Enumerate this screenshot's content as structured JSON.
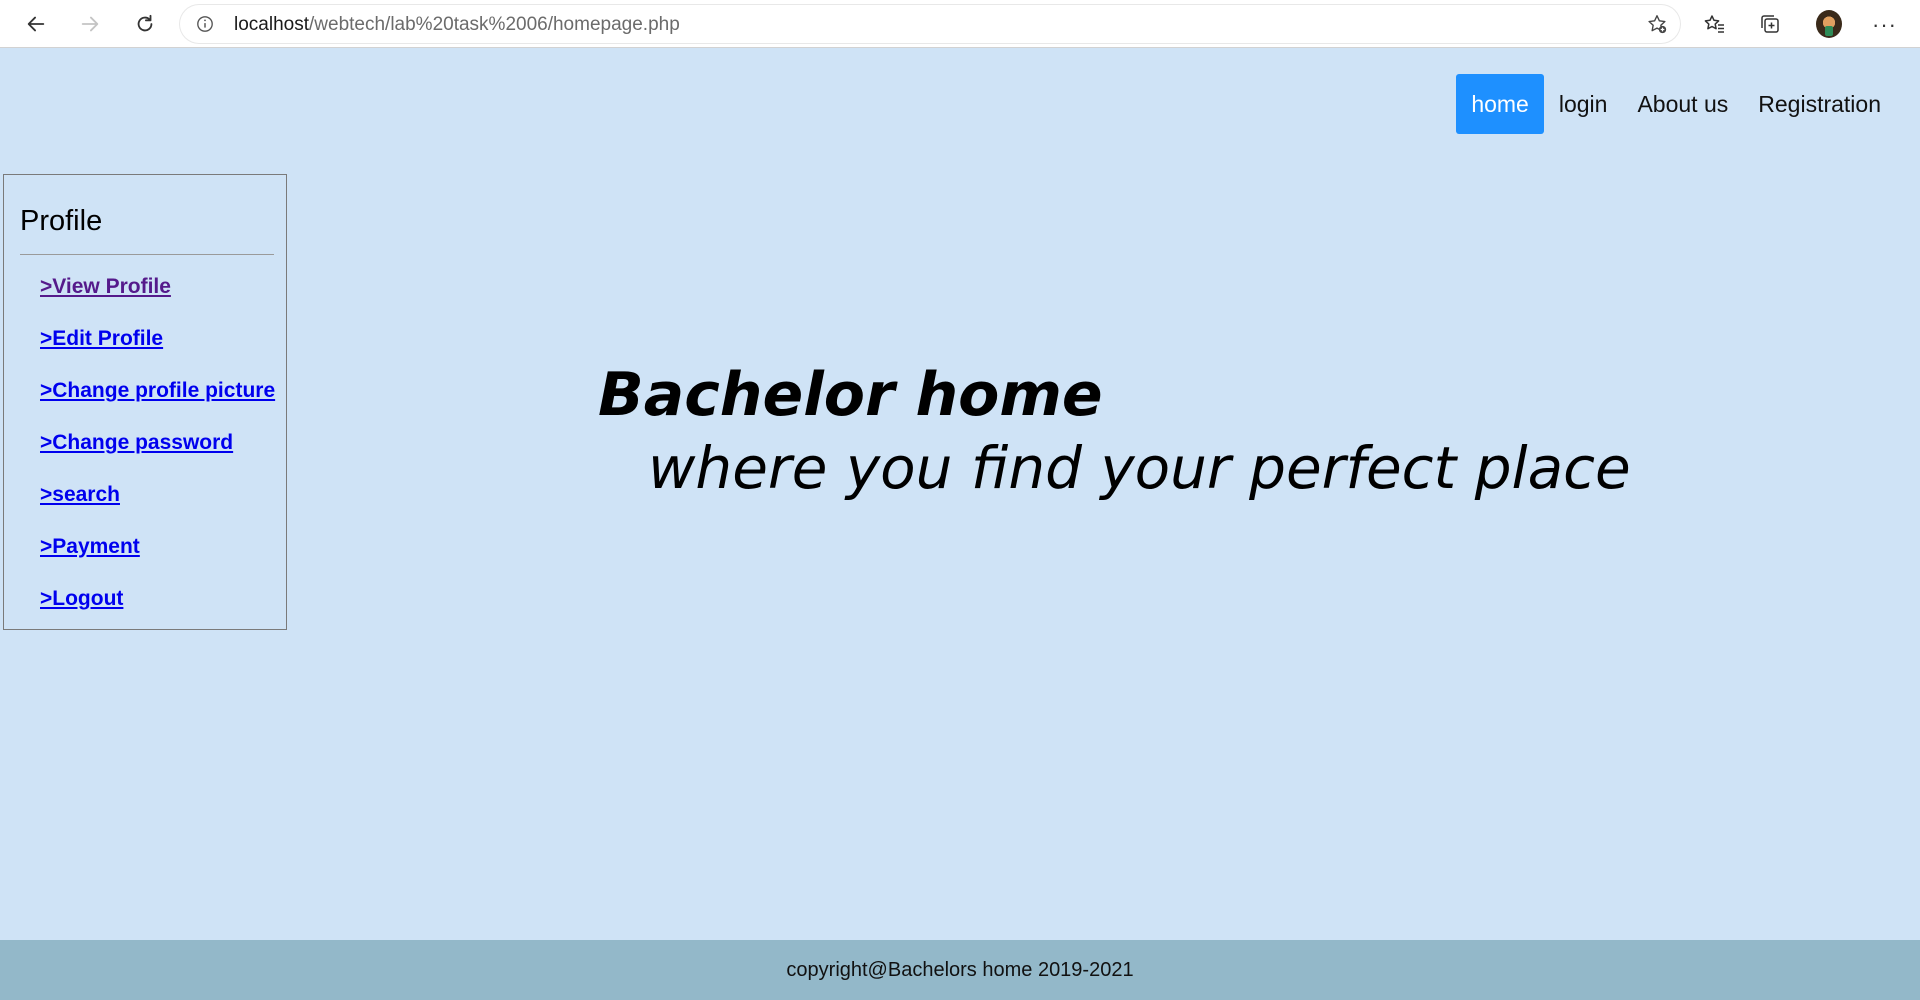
{
  "browser": {
    "url_host": "localhost",
    "url_path": "/webtech/lab%20task%2006/homepage.php",
    "icons": [
      "back-icon",
      "forward-icon",
      "refresh-icon",
      "info-icon",
      "add-favorite-icon",
      "favorites-icon",
      "collections-icon",
      "profile-avatar",
      "more-icon"
    ]
  },
  "topnav": {
    "items": [
      {
        "label": "home",
        "active": true
      },
      {
        "label": "login",
        "active": false
      },
      {
        "label": "About us",
        "active": false
      },
      {
        "label": "Registration",
        "active": false
      }
    ],
    "active_color": "#1e90ff"
  },
  "sidebar": {
    "title": "Profile",
    "items": [
      {
        "label": ">View Profile",
        "visited": true
      },
      {
        "label": ">Edit Profile",
        "visited": false
      },
      {
        "label": ">Change profile picture",
        "visited": false
      },
      {
        "label": ">Change password",
        "visited": false
      },
      {
        "label": ">search",
        "visited": false
      },
      {
        "label": ">Payment",
        "visited": false
      },
      {
        "label": ">Logout",
        "visited": false
      }
    ]
  },
  "hero": {
    "title": "Bachelor home",
    "subtitle": "where you find your perfect place"
  },
  "footer": {
    "text": "copyright@Bachelors home 2019-2021"
  },
  "colors": {
    "page_background": "#cfe3f6",
    "footer_background": "#93b8c9",
    "link": "#0000ee",
    "visited_link": "#551a8b"
  }
}
